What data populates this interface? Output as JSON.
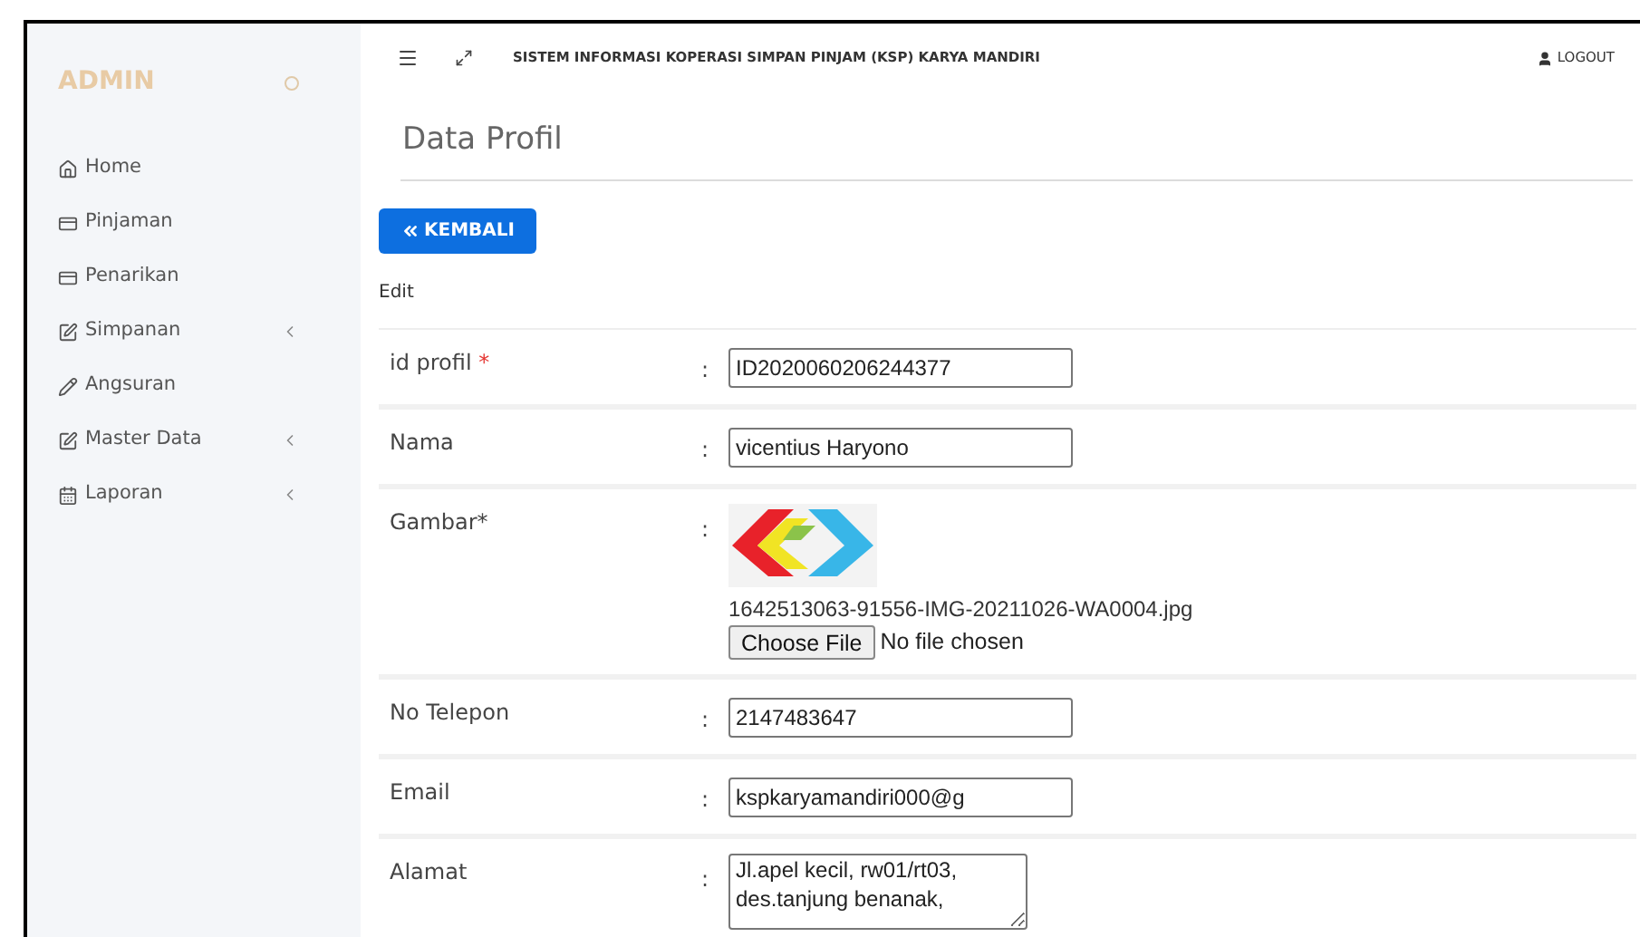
{
  "sidebar": {
    "brand": "ADMIN",
    "items": [
      {
        "label": "Home",
        "has_submenu": false
      },
      {
        "label": "Pinjaman",
        "has_submenu": false
      },
      {
        "label": "Penarikan",
        "has_submenu": false
      },
      {
        "label": "Simpanan",
        "has_submenu": true
      },
      {
        "label": "Angsuran",
        "has_submenu": false
      },
      {
        "label": "Master Data",
        "has_submenu": true
      },
      {
        "label": "Laporan",
        "has_submenu": true
      }
    ]
  },
  "topbar": {
    "title": "SISTEM INFORMASI KOPERASI SIMPAN PINJAM (KSP) KARYA MANDIRI",
    "logout": "LOGOUT"
  },
  "page": {
    "title": "Data Profil",
    "back_button": "KEMBALI",
    "section": "Edit"
  },
  "form": [
    {
      "kind": "input",
      "label": "id profil",
      "required_mark": "*",
      "separator": ":",
      "value": "ID2020060206244377"
    },
    {
      "kind": "input",
      "label": "Nama",
      "separator": ":",
      "value": "vicentius Haryono"
    },
    {
      "kind": "image",
      "label": "Gambar*",
      "separator": ":",
      "filename": "1642513063-91556-IMG-20211026-WA0004.jpg",
      "choose": "Choose File",
      "no_file": "No file chosen"
    },
    {
      "kind": "input",
      "label": "No Telepon",
      "separator": ":",
      "value": "2147483647"
    },
    {
      "kind": "input",
      "label": "Email",
      "separator": ":",
      "value": "kspkaryamandiri000@g"
    },
    {
      "kind": "textarea",
      "label": "Alamat",
      "separator": ":",
      "value": "Jl.apel kecil, rw01/rt03, des.tanjung benanak,"
    }
  ]
}
